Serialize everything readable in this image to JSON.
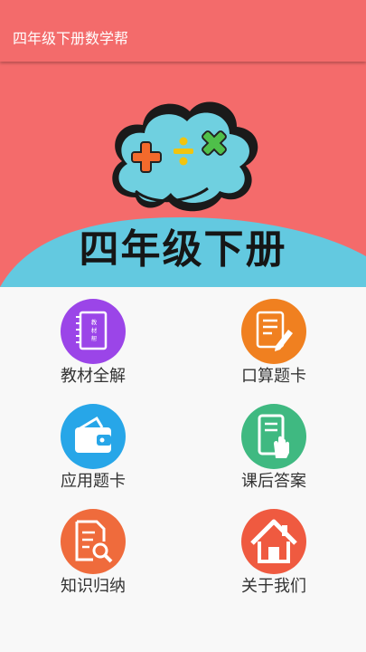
{
  "app": {
    "title": "四年级下册数学帮",
    "theme_color": "#f36b6b"
  },
  "banner": {
    "math_symbols": [
      "+",
      "÷",
      "×"
    ],
    "heading": "四年级下册",
    "cloud_color": "#6fd0e0",
    "wave_color": "#63c9e0"
  },
  "menu": {
    "items": [
      {
        "label": "教材全解",
        "icon": "notebook-icon",
        "icon_text": "教材帮",
        "color": "#9b45e8"
      },
      {
        "label": "口算题卡",
        "icon": "document-pen-icon",
        "color": "#f08020"
      },
      {
        "label": "应用题卡",
        "icon": "wallet-icon",
        "color": "#27a6e8"
      },
      {
        "label": "课后答案",
        "icon": "tablet-touch-icon",
        "color": "#3fb981"
      },
      {
        "label": "知识归纳",
        "icon": "document-search-icon",
        "color": "#ef6b3c"
      },
      {
        "label": "关于我们",
        "icon": "home-icon",
        "color": "#ef5a40"
      }
    ]
  }
}
